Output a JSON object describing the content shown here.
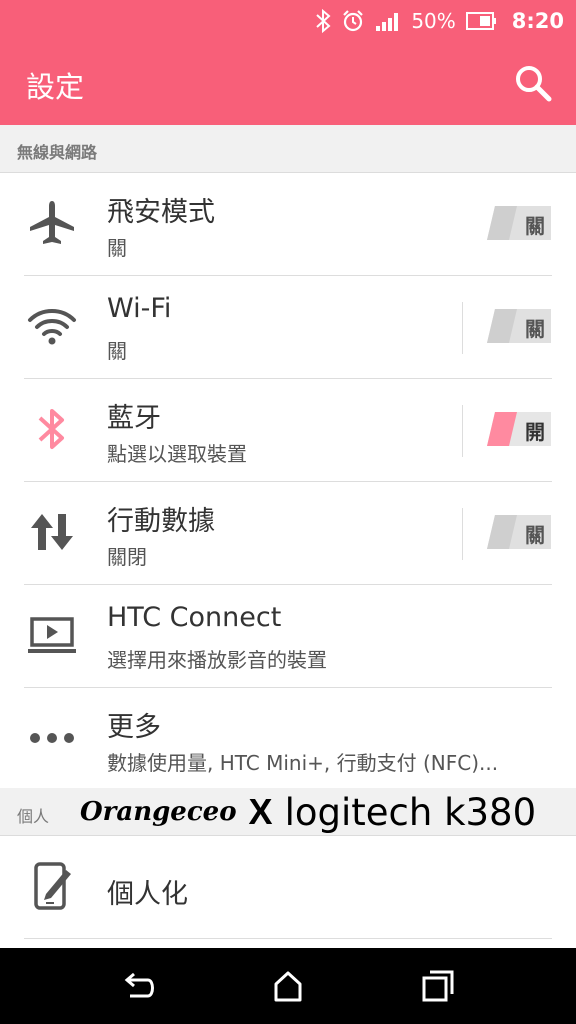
{
  "status_bar": {
    "battery_percent": "50%",
    "time": "8:20",
    "icons": [
      "bluetooth-icon",
      "alarm-icon",
      "signal-icon",
      "battery-icon"
    ]
  },
  "app_bar": {
    "title": "設定",
    "icon": "search-icon"
  },
  "section_wireless": {
    "label": "無線與網路"
  },
  "rows": [
    {
      "title": "飛安模式",
      "subtitle": "關",
      "icon": "airplane-icon",
      "toggle": "關",
      "toggle_on": false
    },
    {
      "title": "Wi-Fi",
      "subtitle": "關",
      "icon": "wifi-icon",
      "toggle": "關",
      "toggle_on": false
    },
    {
      "title": "藍牙",
      "subtitle": "點選以選取裝置",
      "icon": "bluetooth-icon",
      "toggle": "開",
      "toggle_on": true
    },
    {
      "title": "行動數據",
      "subtitle": "關閉",
      "icon": "data-transfer-icon",
      "toggle": "關",
      "toggle_on": false
    },
    {
      "title": "HTC Connect",
      "subtitle": "選擇用來播放影音的裝置",
      "icon": "cast-screen-icon"
    },
    {
      "title": "更多",
      "subtitle": "數據使用量, HTC Mini+, 行動支付 (NFC)...",
      "icon": "more-dots-icon"
    }
  ],
  "section_personal": {
    "label": "個人"
  },
  "watermark": {
    "brand": "Orangeceo",
    "x": "X",
    "product": "logitech k380"
  },
  "personal_rows": [
    {
      "title": "個人化",
      "icon": "personalize-icon"
    }
  ],
  "nav_bar": {
    "icons": [
      "back-icon",
      "home-icon",
      "recents-icon"
    ]
  },
  "colors": {
    "accent": "#f85f79",
    "toggle_off": "#e0e0e0",
    "toggle_on": "#ff8aa0",
    "icon_gray": "#555555"
  }
}
